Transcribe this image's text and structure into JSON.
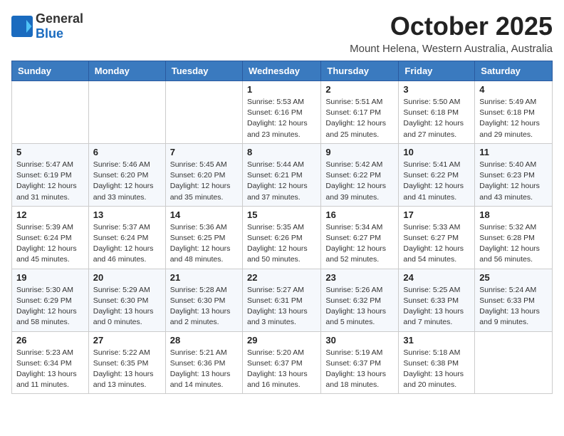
{
  "header": {
    "logo_general": "General",
    "logo_blue": "Blue",
    "month": "October 2025",
    "location": "Mount Helena, Western Australia, Australia"
  },
  "weekdays": [
    "Sunday",
    "Monday",
    "Tuesday",
    "Wednesday",
    "Thursday",
    "Friday",
    "Saturday"
  ],
  "weeks": [
    [
      {
        "day": "",
        "info": ""
      },
      {
        "day": "",
        "info": ""
      },
      {
        "day": "",
        "info": ""
      },
      {
        "day": "1",
        "info": "Sunrise: 5:53 AM\nSunset: 6:16 PM\nDaylight: 12 hours\nand 23 minutes."
      },
      {
        "day": "2",
        "info": "Sunrise: 5:51 AM\nSunset: 6:17 PM\nDaylight: 12 hours\nand 25 minutes."
      },
      {
        "day": "3",
        "info": "Sunrise: 5:50 AM\nSunset: 6:18 PM\nDaylight: 12 hours\nand 27 minutes."
      },
      {
        "day": "4",
        "info": "Sunrise: 5:49 AM\nSunset: 6:18 PM\nDaylight: 12 hours\nand 29 minutes."
      }
    ],
    [
      {
        "day": "5",
        "info": "Sunrise: 5:47 AM\nSunset: 6:19 PM\nDaylight: 12 hours\nand 31 minutes."
      },
      {
        "day": "6",
        "info": "Sunrise: 5:46 AM\nSunset: 6:20 PM\nDaylight: 12 hours\nand 33 minutes."
      },
      {
        "day": "7",
        "info": "Sunrise: 5:45 AM\nSunset: 6:20 PM\nDaylight: 12 hours\nand 35 minutes."
      },
      {
        "day": "8",
        "info": "Sunrise: 5:44 AM\nSunset: 6:21 PM\nDaylight: 12 hours\nand 37 minutes."
      },
      {
        "day": "9",
        "info": "Sunrise: 5:42 AM\nSunset: 6:22 PM\nDaylight: 12 hours\nand 39 minutes."
      },
      {
        "day": "10",
        "info": "Sunrise: 5:41 AM\nSunset: 6:22 PM\nDaylight: 12 hours\nand 41 minutes."
      },
      {
        "day": "11",
        "info": "Sunrise: 5:40 AM\nSunset: 6:23 PM\nDaylight: 12 hours\nand 43 minutes."
      }
    ],
    [
      {
        "day": "12",
        "info": "Sunrise: 5:39 AM\nSunset: 6:24 PM\nDaylight: 12 hours\nand 45 minutes."
      },
      {
        "day": "13",
        "info": "Sunrise: 5:37 AM\nSunset: 6:24 PM\nDaylight: 12 hours\nand 46 minutes."
      },
      {
        "day": "14",
        "info": "Sunrise: 5:36 AM\nSunset: 6:25 PM\nDaylight: 12 hours\nand 48 minutes."
      },
      {
        "day": "15",
        "info": "Sunrise: 5:35 AM\nSunset: 6:26 PM\nDaylight: 12 hours\nand 50 minutes."
      },
      {
        "day": "16",
        "info": "Sunrise: 5:34 AM\nSunset: 6:27 PM\nDaylight: 12 hours\nand 52 minutes."
      },
      {
        "day": "17",
        "info": "Sunrise: 5:33 AM\nSunset: 6:27 PM\nDaylight: 12 hours\nand 54 minutes."
      },
      {
        "day": "18",
        "info": "Sunrise: 5:32 AM\nSunset: 6:28 PM\nDaylight: 12 hours\nand 56 minutes."
      }
    ],
    [
      {
        "day": "19",
        "info": "Sunrise: 5:30 AM\nSunset: 6:29 PM\nDaylight: 12 hours\nand 58 minutes."
      },
      {
        "day": "20",
        "info": "Sunrise: 5:29 AM\nSunset: 6:30 PM\nDaylight: 13 hours\nand 0 minutes."
      },
      {
        "day": "21",
        "info": "Sunrise: 5:28 AM\nSunset: 6:30 PM\nDaylight: 13 hours\nand 2 minutes."
      },
      {
        "day": "22",
        "info": "Sunrise: 5:27 AM\nSunset: 6:31 PM\nDaylight: 13 hours\nand 3 minutes."
      },
      {
        "day": "23",
        "info": "Sunrise: 5:26 AM\nSunset: 6:32 PM\nDaylight: 13 hours\nand 5 minutes."
      },
      {
        "day": "24",
        "info": "Sunrise: 5:25 AM\nSunset: 6:33 PM\nDaylight: 13 hours\nand 7 minutes."
      },
      {
        "day": "25",
        "info": "Sunrise: 5:24 AM\nSunset: 6:33 PM\nDaylight: 13 hours\nand 9 minutes."
      }
    ],
    [
      {
        "day": "26",
        "info": "Sunrise: 5:23 AM\nSunset: 6:34 PM\nDaylight: 13 hours\nand 11 minutes."
      },
      {
        "day": "27",
        "info": "Sunrise: 5:22 AM\nSunset: 6:35 PM\nDaylight: 13 hours\nand 13 minutes."
      },
      {
        "day": "28",
        "info": "Sunrise: 5:21 AM\nSunset: 6:36 PM\nDaylight: 13 hours\nand 14 minutes."
      },
      {
        "day": "29",
        "info": "Sunrise: 5:20 AM\nSunset: 6:37 PM\nDaylight: 13 hours\nand 16 minutes."
      },
      {
        "day": "30",
        "info": "Sunrise: 5:19 AM\nSunset: 6:37 PM\nDaylight: 13 hours\nand 18 minutes."
      },
      {
        "day": "31",
        "info": "Sunrise: 5:18 AM\nSunset: 6:38 PM\nDaylight: 13 hours\nand 20 minutes."
      },
      {
        "day": "",
        "info": ""
      }
    ]
  ]
}
